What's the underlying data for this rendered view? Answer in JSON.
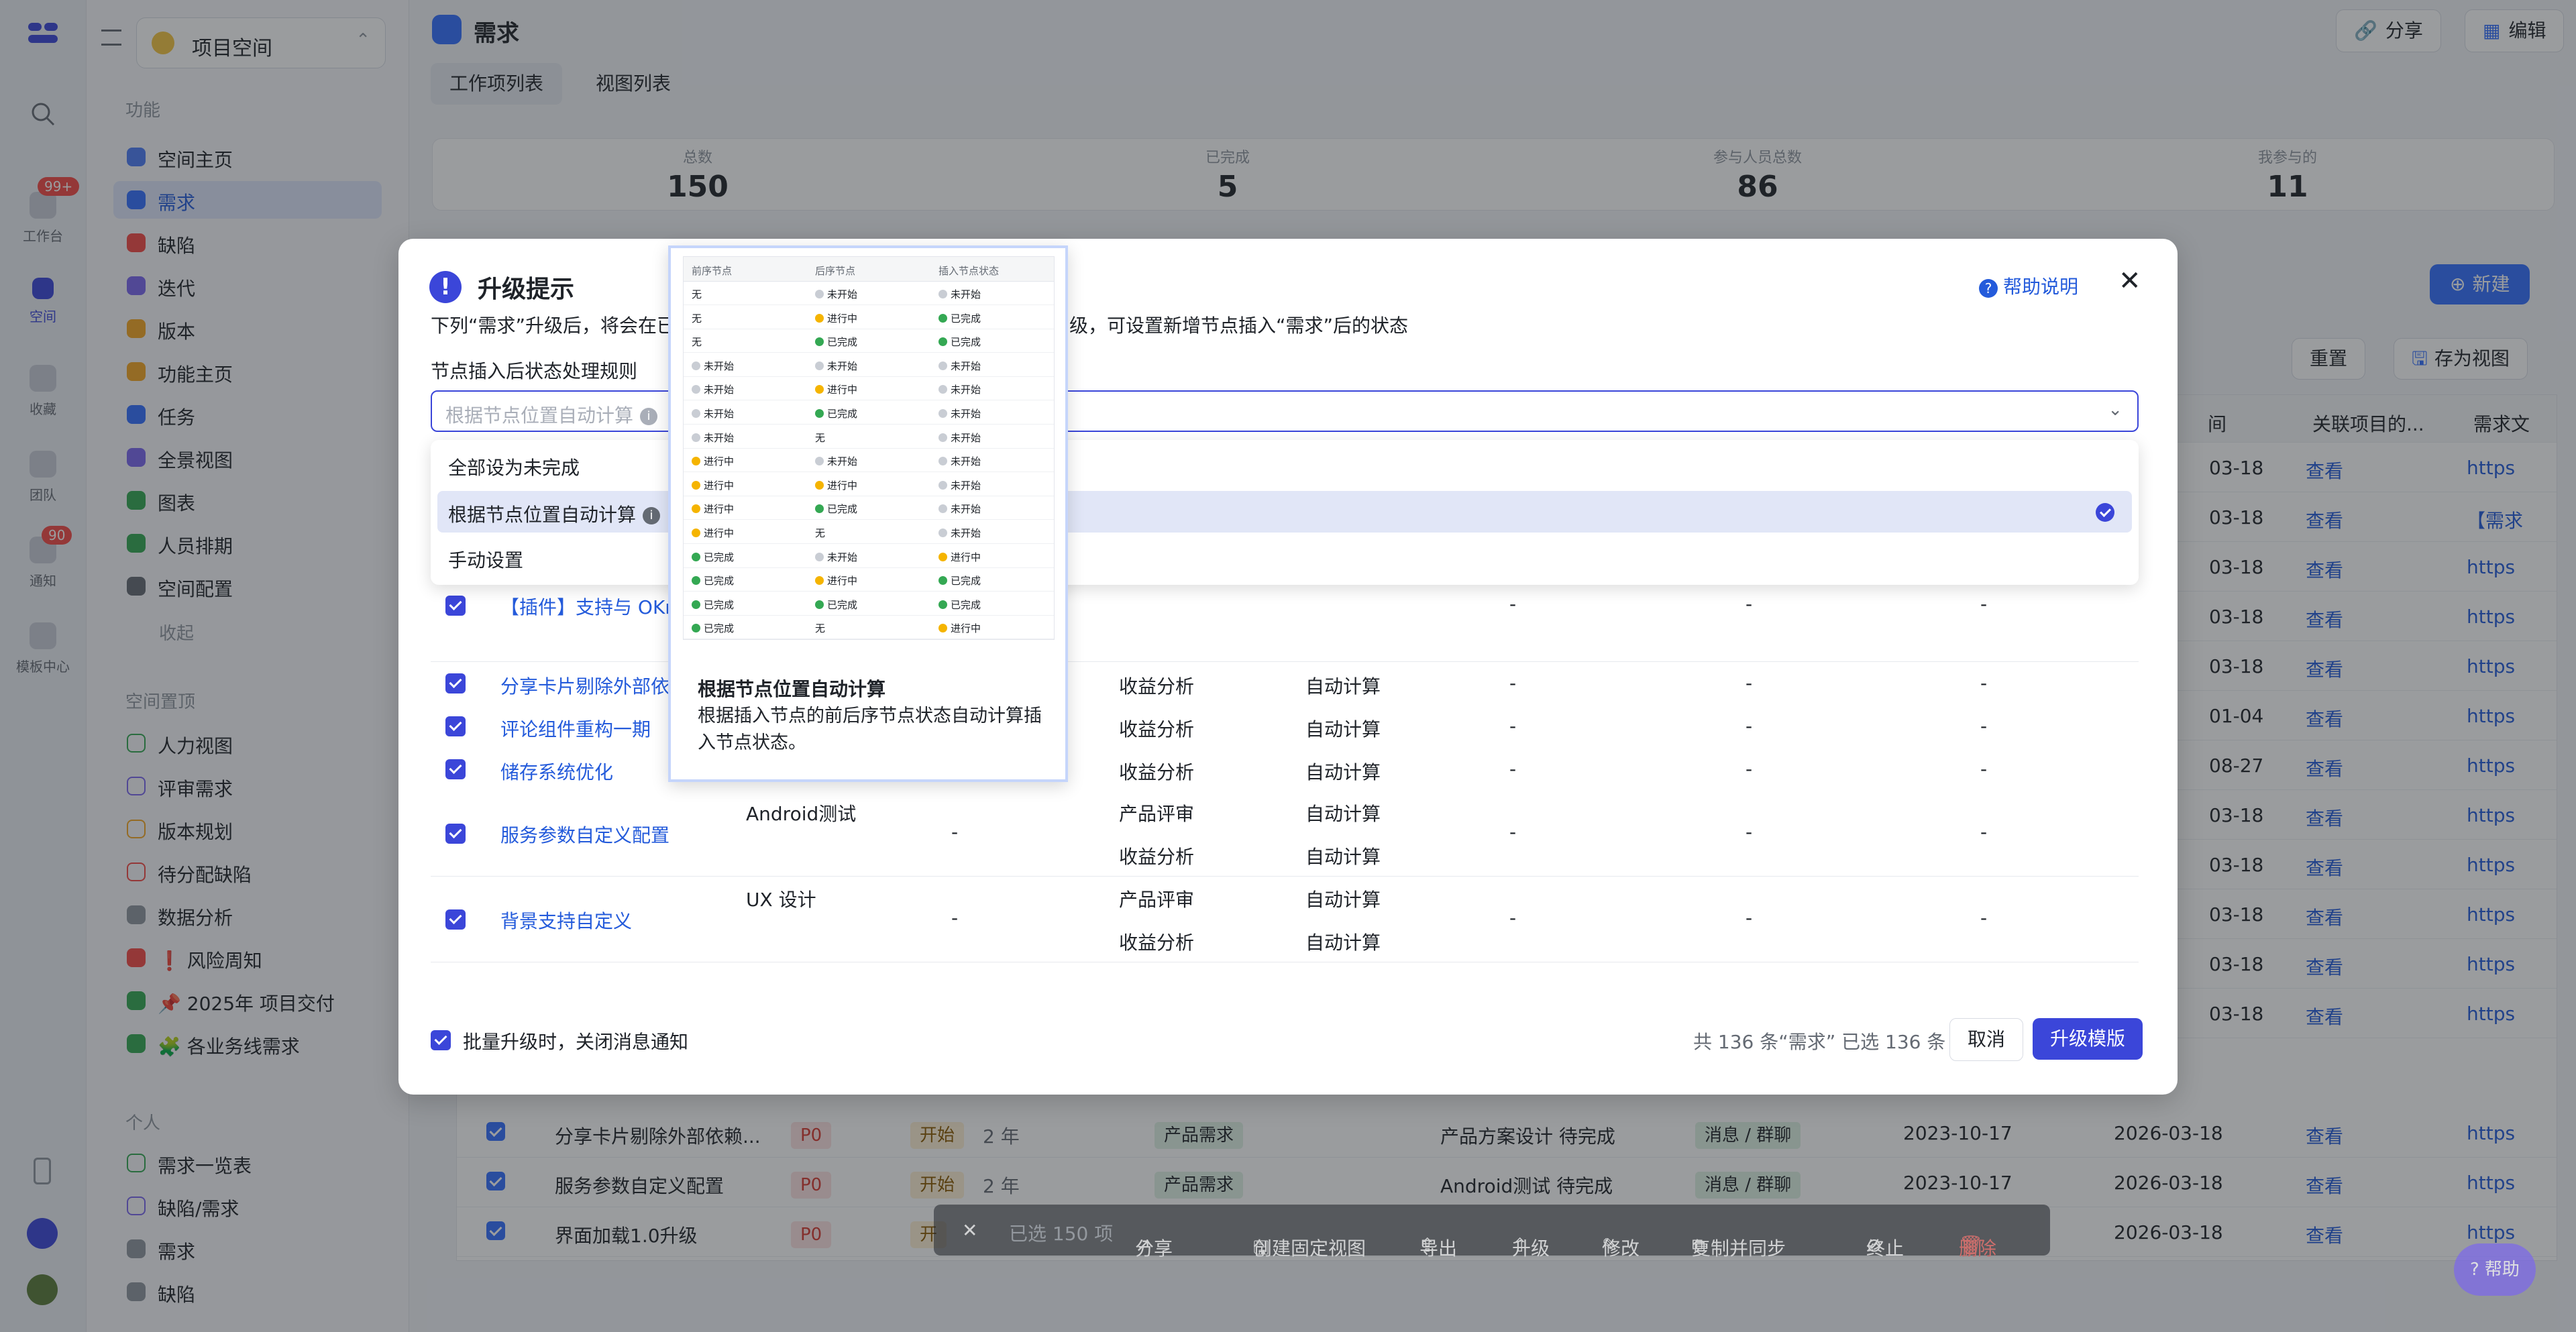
{
  "rail": {
    "items": [
      {
        "label": "工作台",
        "badge": "99+"
      },
      {
        "label": "空间"
      },
      {
        "label": "收藏"
      },
      {
        "label": "团队"
      },
      {
        "label": "通知",
        "badge": "90"
      },
      {
        "label": "模板中心"
      }
    ]
  },
  "sidebar": {
    "space_name": "项目空间",
    "section_features": "功能",
    "items": [
      {
        "label": "空间主页",
        "color": "#4e7cf6"
      },
      {
        "label": "需求",
        "color": "#3370ff"
      },
      {
        "label": "缺陷",
        "color": "#f54a45"
      },
      {
        "label": "迭代",
        "color": "#7b67ee"
      },
      {
        "label": "版本",
        "color": "#f5a623"
      },
      {
        "label": "功能主页",
        "color": "#f5a623"
      },
      {
        "label": "任务",
        "color": "#3370ff"
      },
      {
        "label": "全景视图",
        "color": "#7b67ee"
      },
      {
        "label": "图表",
        "color": "#34a853"
      },
      {
        "label": "人员排期",
        "color": "#34a853"
      },
      {
        "label": "空间配置",
        "color": "#646a73"
      }
    ],
    "collapse": "收起",
    "section_pinned": "空间置顶",
    "pinned": [
      {
        "label": "人力视图"
      },
      {
        "label": "评审需求"
      },
      {
        "label": "版本规划"
      },
      {
        "label": "待分配缺陷"
      },
      {
        "label": "数据分析"
      },
      {
        "label": "❗ 风险周知"
      },
      {
        "label": "📌 2025年 项目交付"
      },
      {
        "label": "🧩 各业务线需求"
      }
    ],
    "section_personal": "个人",
    "personal": [
      {
        "label": "需求一览表"
      },
      {
        "label": "缺陷/需求"
      },
      {
        "label": "需求"
      },
      {
        "label": "缺陷"
      }
    ]
  },
  "main": {
    "title": "需求",
    "share_label": "分享",
    "edit_label": "编辑",
    "tabs": [
      {
        "label": "工作项列表"
      },
      {
        "label": "视图列表"
      }
    ],
    "stats": [
      {
        "label": "总数",
        "value": "150"
      },
      {
        "label": "已完成",
        "value": "5"
      },
      {
        "label": "参与人员总数",
        "value": "86"
      },
      {
        "label": "我参与的",
        "value": "11"
      }
    ],
    "new_label": "新建",
    "reset_label": "重置",
    "save_view_label": "存为视图",
    "col_time": "间",
    "col_related": "关联项目的...",
    "col_doc": "需求文",
    "right_rows": [
      {
        "date": "03-18",
        "view": "查看",
        "doc": "https"
      },
      {
        "date": "03-18",
        "view": "查看",
        "doc": "【需求"
      },
      {
        "date": "03-18",
        "view": "查看",
        "doc": "https"
      },
      {
        "date": "03-18",
        "view": "查看",
        "doc": "https"
      },
      {
        "date": "03-18",
        "view": "查看",
        "doc": "https"
      },
      {
        "date": "01-04",
        "view": "查看",
        "doc": "https"
      },
      {
        "date": "08-27",
        "view": "查看",
        "doc": "https"
      },
      {
        "date": "03-18",
        "view": "查看",
        "doc": "https"
      },
      {
        "date": "03-18",
        "view": "查看",
        "doc": "https"
      },
      {
        "date": "03-18",
        "view": "查看",
        "doc": "https"
      },
      {
        "date": "03-18",
        "view": "查看",
        "doc": "https"
      },
      {
        "date": "03-18",
        "view": "查看",
        "doc": "https"
      }
    ],
    "rows": [
      {
        "name": "分享卡片剔除外部依赖...",
        "priority": "P0",
        "status": "开始",
        "age": "2 年",
        "type": "产品需求",
        "node": "产品方案设计 待完成",
        "channel": "消息 / 群聊",
        "start": "2023-10-17",
        "end": "2026-03-18",
        "view": "查看",
        "doc": "https"
      },
      {
        "name": "服务参数自定义配置",
        "priority": "P0",
        "status": "开始",
        "age": "2 年",
        "type": "产品需求",
        "node": "Android测试 待完成",
        "channel": "消息 / 群聊",
        "start": "2023-10-17",
        "end": "2026-03-18",
        "view": "查看",
        "doc": "https"
      },
      {
        "name": "界面加载1.0升级",
        "priority": "P0",
        "status": "开",
        "age": "",
        "type": "",
        "node": "",
        "channel": "",
        "start": "",
        "end": "2026-03-18",
        "view": "查看",
        "doc": "https"
      }
    ],
    "bulk_bar": {
      "selected": "已选 150 项",
      "share": "分享",
      "fixed_view": "创建固定视图",
      "export": "导出",
      "upgrade": "升级",
      "modify": "修改",
      "copy_sync": "复制并同步",
      "terminate": "终止",
      "delete": "删除"
    },
    "help_float": "帮助"
  },
  "modal": {
    "title": "升级提示",
    "desc_left": "下列“需求”升级后，将会在已",
    "desc_right": "级，可设置新增节点插入“需求”后的状态",
    "help_link": "帮助说明",
    "rule_label": "节点插入后状态处理规则",
    "rule_placeholder": "根据节点位置自动计算",
    "options": [
      {
        "label": "全部设为未完成"
      },
      {
        "label": "根据节点位置自动计算"
      },
      {
        "label": "手动设置"
      }
    ],
    "rows": [
      {
        "name": "【插件】支持与 OKr",
        "node": "",
        "stage": "",
        "rule": "",
        "c1": "-",
        "c2": "-",
        "c3": "-"
      },
      {
        "name": "分享卡片剔除外部依",
        "node": "",
        "stage": "收益分析",
        "rule": "自动计算",
        "c1": "-",
        "c2": "-",
        "c3": "-"
      },
      {
        "name": "评论组件重构一期",
        "node": "",
        "stage": "收益分析",
        "rule": "自动计算",
        "c1": "-",
        "c2": "-",
        "c3": "-"
      },
      {
        "name": "储存系统优化",
        "node": "",
        "stage": "收益分析",
        "rule": "自动计算",
        "c1": "-",
        "c2": "-",
        "c3": "-"
      },
      {
        "name": "服务参数自定义配置",
        "node": "Android测试",
        "dash": "-",
        "stage": "产品评审",
        "rule": "自动计算",
        "stage2": "收益分析",
        "rule2": "自动计算",
        "c1": "-",
        "c2": "-",
        "c3": "-"
      },
      {
        "name": "背景支持自定义",
        "node": "UX 设计",
        "dash": "-",
        "stage": "产品评审",
        "rule": "自动计算",
        "stage2": "收益分析",
        "rule2": "自动计算",
        "c1": "-",
        "c2": "-",
        "c3": "-"
      }
    ],
    "footer_checkbox": "批量升级时，关闭消息通知",
    "footer_count": "共 136 条“需求” 已选 136 条",
    "cancel": "取消",
    "confirm": "升级模版"
  },
  "preview": {
    "headers": [
      "前序节点",
      "后序节点",
      "插入节点状态"
    ],
    "rows": [
      [
        {
          "t": "无",
          "c": ""
        },
        {
          "t": "未开始",
          "c": "#c9cdd4"
        },
        {
          "t": "未开始",
          "c": "#c9cdd4"
        }
      ],
      [
        {
          "t": "无",
          "c": ""
        },
        {
          "t": "进行中",
          "c": "#f5b400"
        },
        {
          "t": "已完成",
          "c": "#34a853"
        }
      ],
      [
        {
          "t": "无",
          "c": ""
        },
        {
          "t": "已完成",
          "c": "#34a853"
        },
        {
          "t": "已完成",
          "c": "#34a853"
        }
      ],
      [
        {
          "t": "未开始",
          "c": "#c9cdd4"
        },
        {
          "t": "未开始",
          "c": "#c9cdd4"
        },
        {
          "t": "未开始",
          "c": "#c9cdd4"
        }
      ],
      [
        {
          "t": "未开始",
          "c": "#c9cdd4"
        },
        {
          "t": "进行中",
          "c": "#f5b400"
        },
        {
          "t": "未开始",
          "c": "#c9cdd4"
        }
      ],
      [
        {
          "t": "未开始",
          "c": "#c9cdd4"
        },
        {
          "t": "已完成",
          "c": "#34a853"
        },
        {
          "t": "未开始",
          "c": "#c9cdd4"
        }
      ],
      [
        {
          "t": "未开始",
          "c": "#c9cdd4"
        },
        {
          "t": "无",
          "c": ""
        },
        {
          "t": "未开始",
          "c": "#c9cdd4"
        }
      ],
      [
        {
          "t": "进行中",
          "c": "#f5b400"
        },
        {
          "t": "未开始",
          "c": "#c9cdd4"
        },
        {
          "t": "未开始",
          "c": "#c9cdd4"
        }
      ],
      [
        {
          "t": "进行中",
          "c": "#f5b400"
        },
        {
          "t": "进行中",
          "c": "#f5b400"
        },
        {
          "t": "未开始",
          "c": "#c9cdd4"
        }
      ],
      [
        {
          "t": "进行中",
          "c": "#f5b400"
        },
        {
          "t": "已完成",
          "c": "#34a853"
        },
        {
          "t": "未开始",
          "c": "#c9cdd4"
        }
      ],
      [
        {
          "t": "进行中",
          "c": "#f5b400"
        },
        {
          "t": "无",
          "c": ""
        },
        {
          "t": "未开始",
          "c": "#c9cdd4"
        }
      ],
      [
        {
          "t": "已完成",
          "c": "#34a853"
        },
        {
          "t": "未开始",
          "c": "#c9cdd4"
        },
        {
          "t": "进行中",
          "c": "#f5b400"
        }
      ],
      [
        {
          "t": "已完成",
          "c": "#34a853"
        },
        {
          "t": "进行中",
          "c": "#f5b400"
        },
        {
          "t": "已完成",
          "c": "#34a853"
        }
      ],
      [
        {
          "t": "已完成",
          "c": "#34a853"
        },
        {
          "t": "已完成",
          "c": "#34a853"
        },
        {
          "t": "已完成",
          "c": "#34a853"
        }
      ],
      [
        {
          "t": "已完成",
          "c": "#34a853"
        },
        {
          "t": "无",
          "c": ""
        },
        {
          "t": "进行中",
          "c": "#f5b400"
        }
      ]
    ],
    "title": "根据节点位置自动计算",
    "desc": "根据插入节点的前后序节点状态自动计算插入节点状态。"
  },
  "colors": {
    "accent": "#3b46d9",
    "primary": "#3370ff",
    "danger": "#f54a45"
  }
}
